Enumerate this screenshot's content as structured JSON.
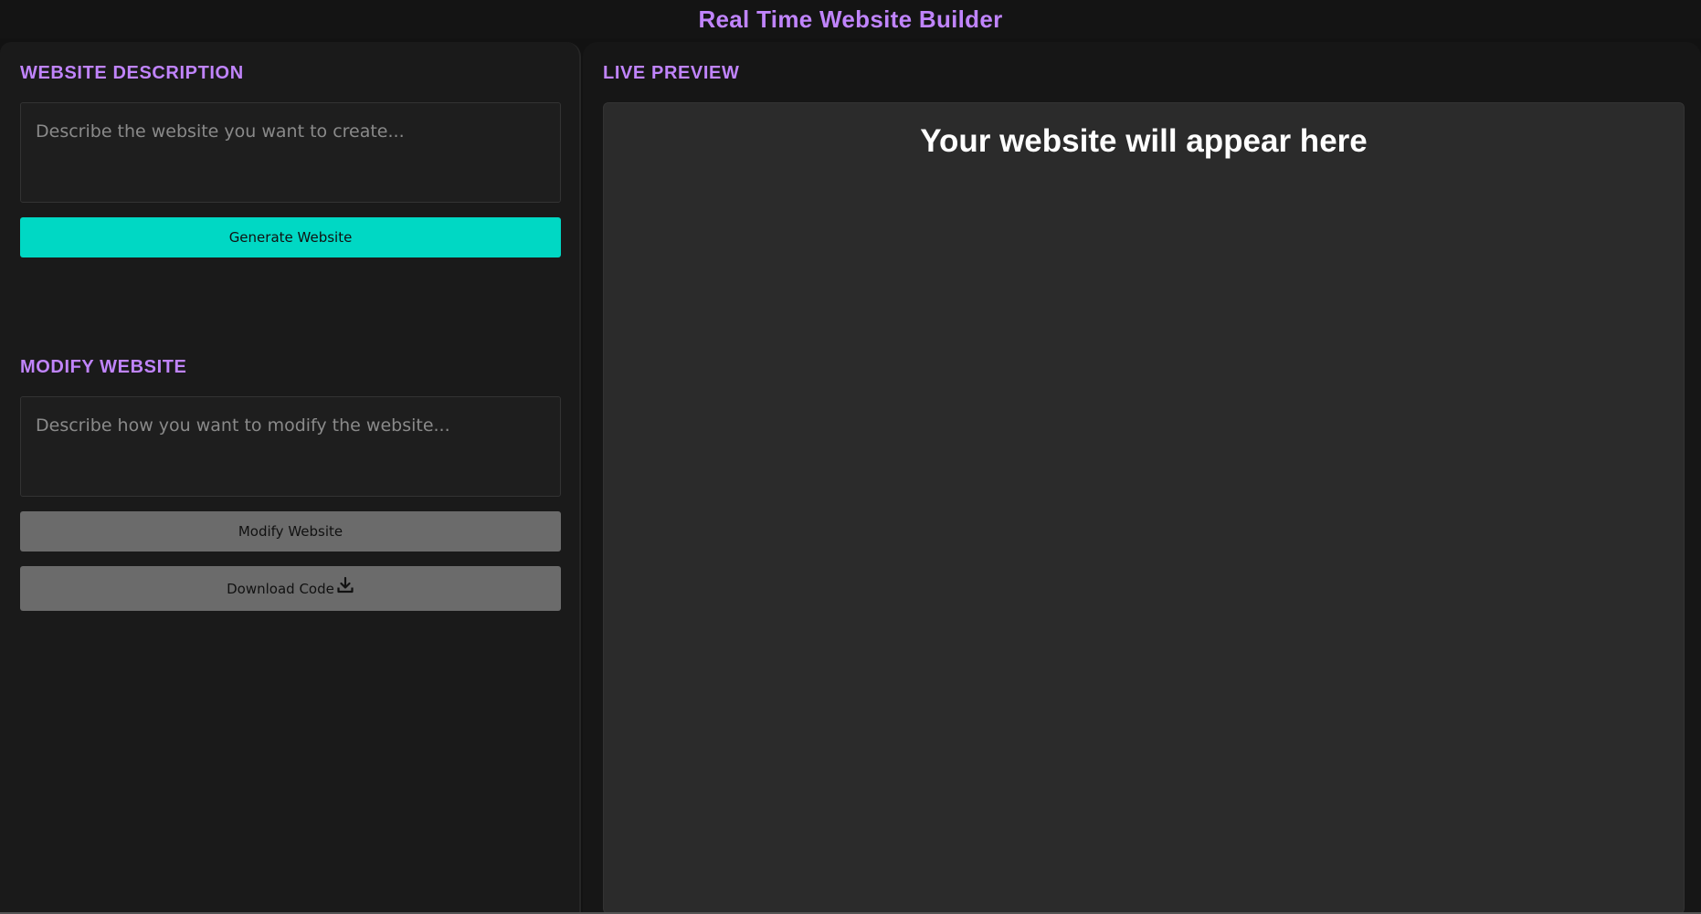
{
  "app": {
    "title": "Real Time Website Builder"
  },
  "description_section": {
    "heading": "WEBSITE DESCRIPTION",
    "input_placeholder": "Describe the website you want to create...",
    "input_value": "",
    "generate_label": "Generate Website"
  },
  "modify_section": {
    "heading": "MODIFY WEBSITE",
    "input_placeholder": "Describe how you want to modify the website...",
    "input_value": "",
    "modify_label": "Modify Website",
    "download_label": "Download Code",
    "download_icon": "download-icon"
  },
  "preview": {
    "heading": "LIVE PREVIEW",
    "placeholder_text": "Your website will appear here"
  },
  "colors": {
    "accent_purple": "#c084fc",
    "generate_button": "#00d8c4",
    "secondary_button": "#6b6b6b",
    "background": "#1a1a1a"
  }
}
